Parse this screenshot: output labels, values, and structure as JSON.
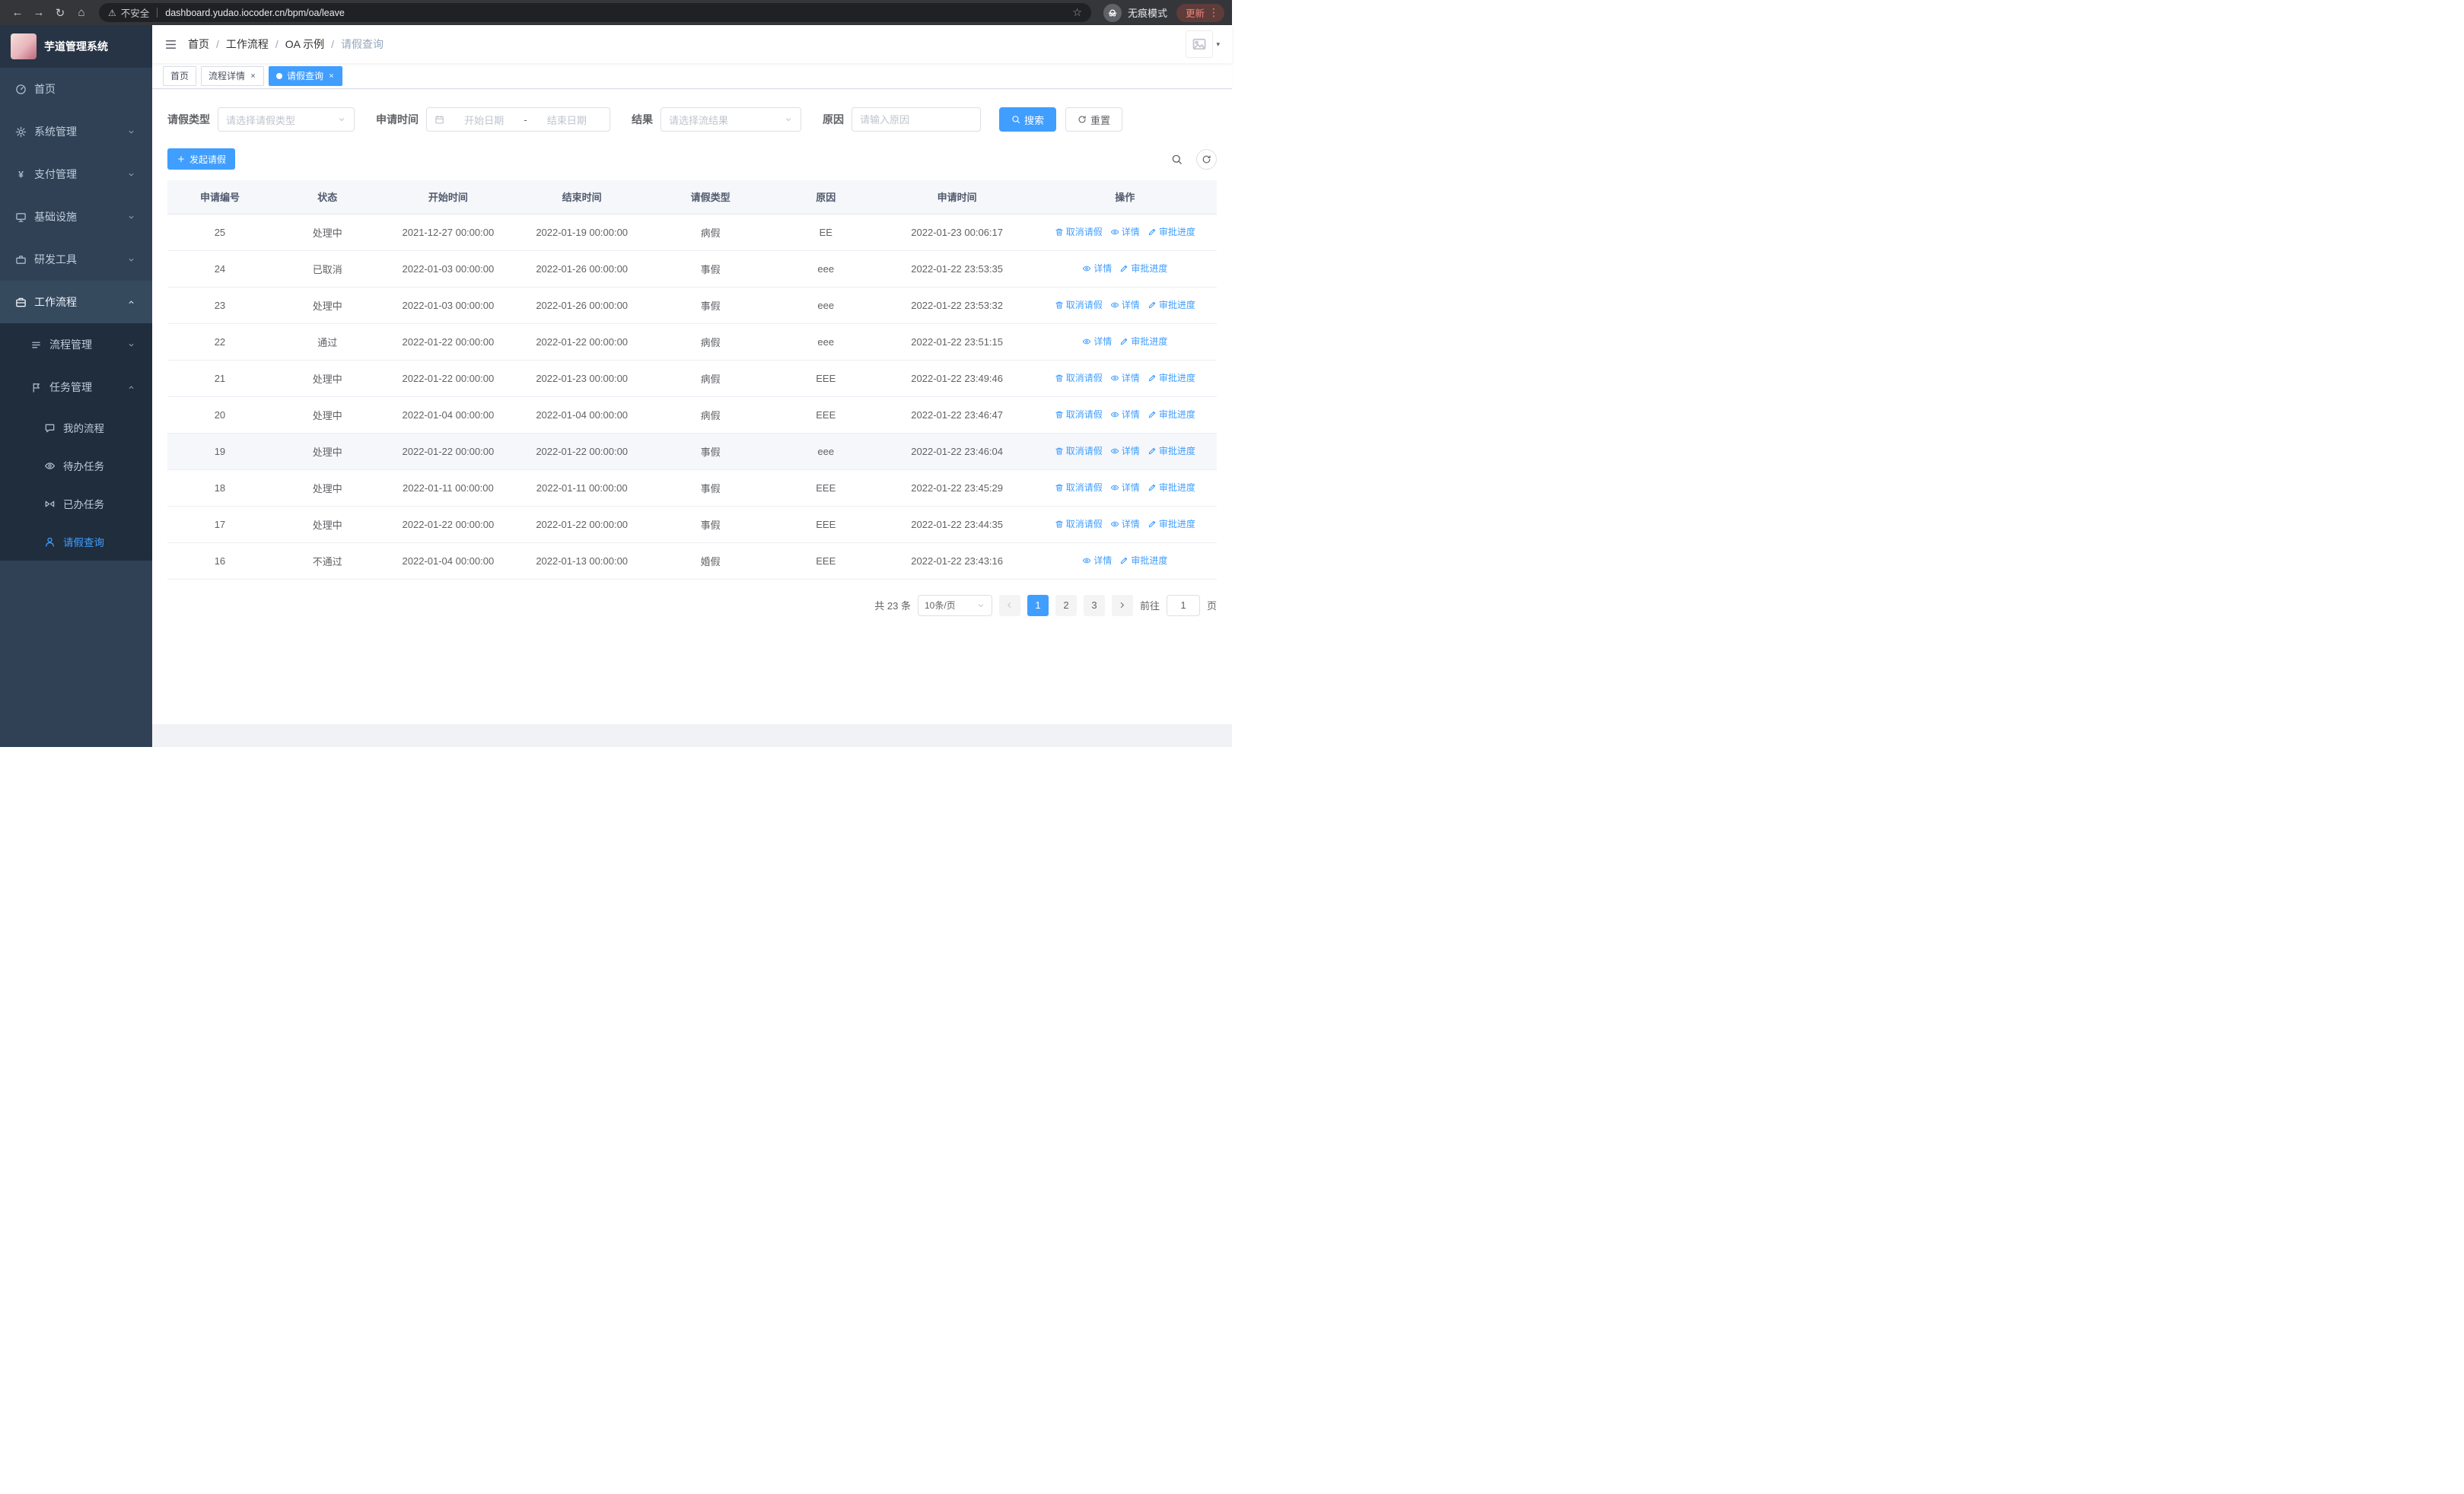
{
  "colors": {
    "primary": "#409EFF",
    "sidebar_bg": "#304156",
    "submenu_bg": "#1f2d3d",
    "tab_active_bg": "#409EFF"
  },
  "browser": {
    "security_label": "不安全",
    "url": "dashboard.yudao.iocoder.cn/bpm/oa/leave",
    "incognito_label": "无痕模式",
    "update_label": "更新"
  },
  "app_title": "芋道管理系统",
  "sidebar": {
    "items": [
      {
        "key": "home",
        "label": "首页",
        "icon": "dashboard-icon",
        "level": 1
      },
      {
        "key": "system",
        "label": "系统管理",
        "icon": "gear-icon",
        "level": 1,
        "chevron": "down"
      },
      {
        "key": "payment",
        "label": "支付管理",
        "icon": "yen-icon",
        "level": 1,
        "chevron": "down"
      },
      {
        "key": "infra",
        "label": "基础设施",
        "icon": "infra-icon",
        "level": 1,
        "chevron": "down"
      },
      {
        "key": "devtools",
        "label": "研发工具",
        "icon": "tools-icon",
        "level": 1,
        "chevron": "down"
      },
      {
        "key": "workflow",
        "label": "工作流程",
        "icon": "workflow-icon",
        "level": 1,
        "chevron": "up",
        "active_parent": true
      },
      {
        "key": "process-mgmt",
        "label": "流程管理",
        "icon": "process-icon",
        "level": 2,
        "chevron": "down"
      },
      {
        "key": "task-mgmt",
        "label": "任务管理",
        "icon": "task-icon",
        "level": 2,
        "chevron": "up"
      },
      {
        "key": "my-process",
        "label": "我的流程",
        "icon": "chat-icon",
        "level": 3
      },
      {
        "key": "todo-tasks",
        "label": "待办任务",
        "icon": "eye-icon",
        "level": 3
      },
      {
        "key": "done-tasks",
        "label": "已办任务",
        "icon": "done-icon",
        "level": 3
      },
      {
        "key": "leave-query",
        "label": "请假查询",
        "icon": "person-icon",
        "level": 3,
        "active": true
      }
    ]
  },
  "header": {
    "breadcrumb": [
      {
        "label": "首页",
        "current": false
      },
      {
        "label": "工作流程",
        "current": false
      },
      {
        "label": "OA 示例",
        "current": false
      },
      {
        "label": "请假查询",
        "current": true
      }
    ],
    "icons": [
      {
        "key": "search",
        "name": "search-icon"
      },
      {
        "key": "github",
        "name": "github-icon"
      },
      {
        "key": "help",
        "name": "help-icon"
      },
      {
        "key": "fullscreen",
        "name": "fullscreen-icon"
      },
      {
        "key": "fontsize",
        "name": "font-size-icon"
      }
    ]
  },
  "tabs": [
    {
      "key": "home",
      "label": "首页",
      "closable": false,
      "active": false
    },
    {
      "key": "process-detail",
      "label": "流程详情",
      "closable": true,
      "active": false
    },
    {
      "key": "leave-query",
      "label": "请假查询",
      "closable": true,
      "active": true
    }
  ],
  "filters": {
    "leave_type_label": "请假类型",
    "leave_type_placeholder": "请选择请假类型",
    "apply_time_label": "申请时间",
    "start_date_placeholder": "开始日期",
    "range_separator": "-",
    "end_date_placeholder": "结束日期",
    "result_label": "结果",
    "result_placeholder": "请选择流结果",
    "reason_label": "原因",
    "reason_placeholder": "请输入原因",
    "search_button": "搜索",
    "reset_button": "重置"
  },
  "toolbar": {
    "create_button": "发起请假"
  },
  "table": {
    "columns": [
      "申请编号",
      "状态",
      "开始时间",
      "结束时间",
      "请假类型",
      "原因",
      "申请时间",
      "操作"
    ],
    "action_defs": {
      "cancel": {
        "label": "取消请假",
        "icon": "trash-icon"
      },
      "detail": {
        "label": "详情",
        "icon": "eye-icon"
      },
      "progress": {
        "label": "审批进度",
        "icon": "edit-icon"
      }
    },
    "rows": [
      {
        "id": "25",
        "status": "处理中",
        "start": "2021-12-27 00:00:00",
        "end": "2022-01-19 00:00:00",
        "type": "病假",
        "reason": "EE",
        "apply_time": "2022-01-23 00:06:17",
        "actions": [
          "cancel",
          "detail",
          "progress"
        ]
      },
      {
        "id": "24",
        "status": "已取消",
        "start": "2022-01-03 00:00:00",
        "end": "2022-01-26 00:00:00",
        "type": "事假",
        "reason": "eee",
        "apply_time": "2022-01-22 23:53:35",
        "actions": [
          "detail",
          "progress"
        ]
      },
      {
        "id": "23",
        "status": "处理中",
        "start": "2022-01-03 00:00:00",
        "end": "2022-01-26 00:00:00",
        "type": "事假",
        "reason": "eee",
        "apply_time": "2022-01-22 23:53:32",
        "actions": [
          "cancel",
          "detail",
          "progress"
        ]
      },
      {
        "id": "22",
        "status": "通过",
        "start": "2022-01-22 00:00:00",
        "end": "2022-01-22 00:00:00",
        "type": "病假",
        "reason": "eee",
        "apply_time": "2022-01-22 23:51:15",
        "actions": [
          "detail",
          "progress"
        ]
      },
      {
        "id": "21",
        "status": "处理中",
        "start": "2022-01-22 00:00:00",
        "end": "2022-01-23 00:00:00",
        "type": "病假",
        "reason": "EEE",
        "apply_time": "2022-01-22 23:49:46",
        "actions": [
          "cancel",
          "detail",
          "progress"
        ]
      },
      {
        "id": "20",
        "status": "处理中",
        "start": "2022-01-04 00:00:00",
        "end": "2022-01-04 00:00:00",
        "type": "病假",
        "reason": "EEE",
        "apply_time": "2022-01-22 23:46:47",
        "actions": [
          "cancel",
          "detail",
          "progress"
        ]
      },
      {
        "id": "19",
        "status": "处理中",
        "start": "2022-01-22 00:00:00",
        "end": "2022-01-22 00:00:00",
        "type": "事假",
        "reason": "eee",
        "apply_time": "2022-01-22 23:46:04",
        "actions": [
          "cancel",
          "detail",
          "progress"
        ],
        "highlighted": true
      },
      {
        "id": "18",
        "status": "处理中",
        "start": "2022-01-11 00:00:00",
        "end": "2022-01-11 00:00:00",
        "type": "事假",
        "reason": "EEE",
        "apply_time": "2022-01-22 23:45:29",
        "actions": [
          "cancel",
          "detail",
          "progress"
        ]
      },
      {
        "id": "17",
        "status": "处理中",
        "start": "2022-01-22 00:00:00",
        "end": "2022-01-22 00:00:00",
        "type": "事假",
        "reason": "EEE",
        "apply_time": "2022-01-22 23:44:35",
        "actions": [
          "cancel",
          "detail",
          "progress"
        ]
      },
      {
        "id": "16",
        "status": "不通过",
        "start": "2022-01-04 00:00:00",
        "end": "2022-01-13 00:00:00",
        "type": "婚假",
        "reason": "EEE",
        "apply_time": "2022-01-22 23:43:16",
        "actions": [
          "detail",
          "progress"
        ]
      }
    ]
  },
  "pagination": {
    "total_text": "共 23 条",
    "page_size": "10条/页",
    "pages": [
      "1",
      "2",
      "3"
    ],
    "active_page": "1",
    "goto_label": "前往",
    "goto_value": "1",
    "page_unit": "页"
  }
}
